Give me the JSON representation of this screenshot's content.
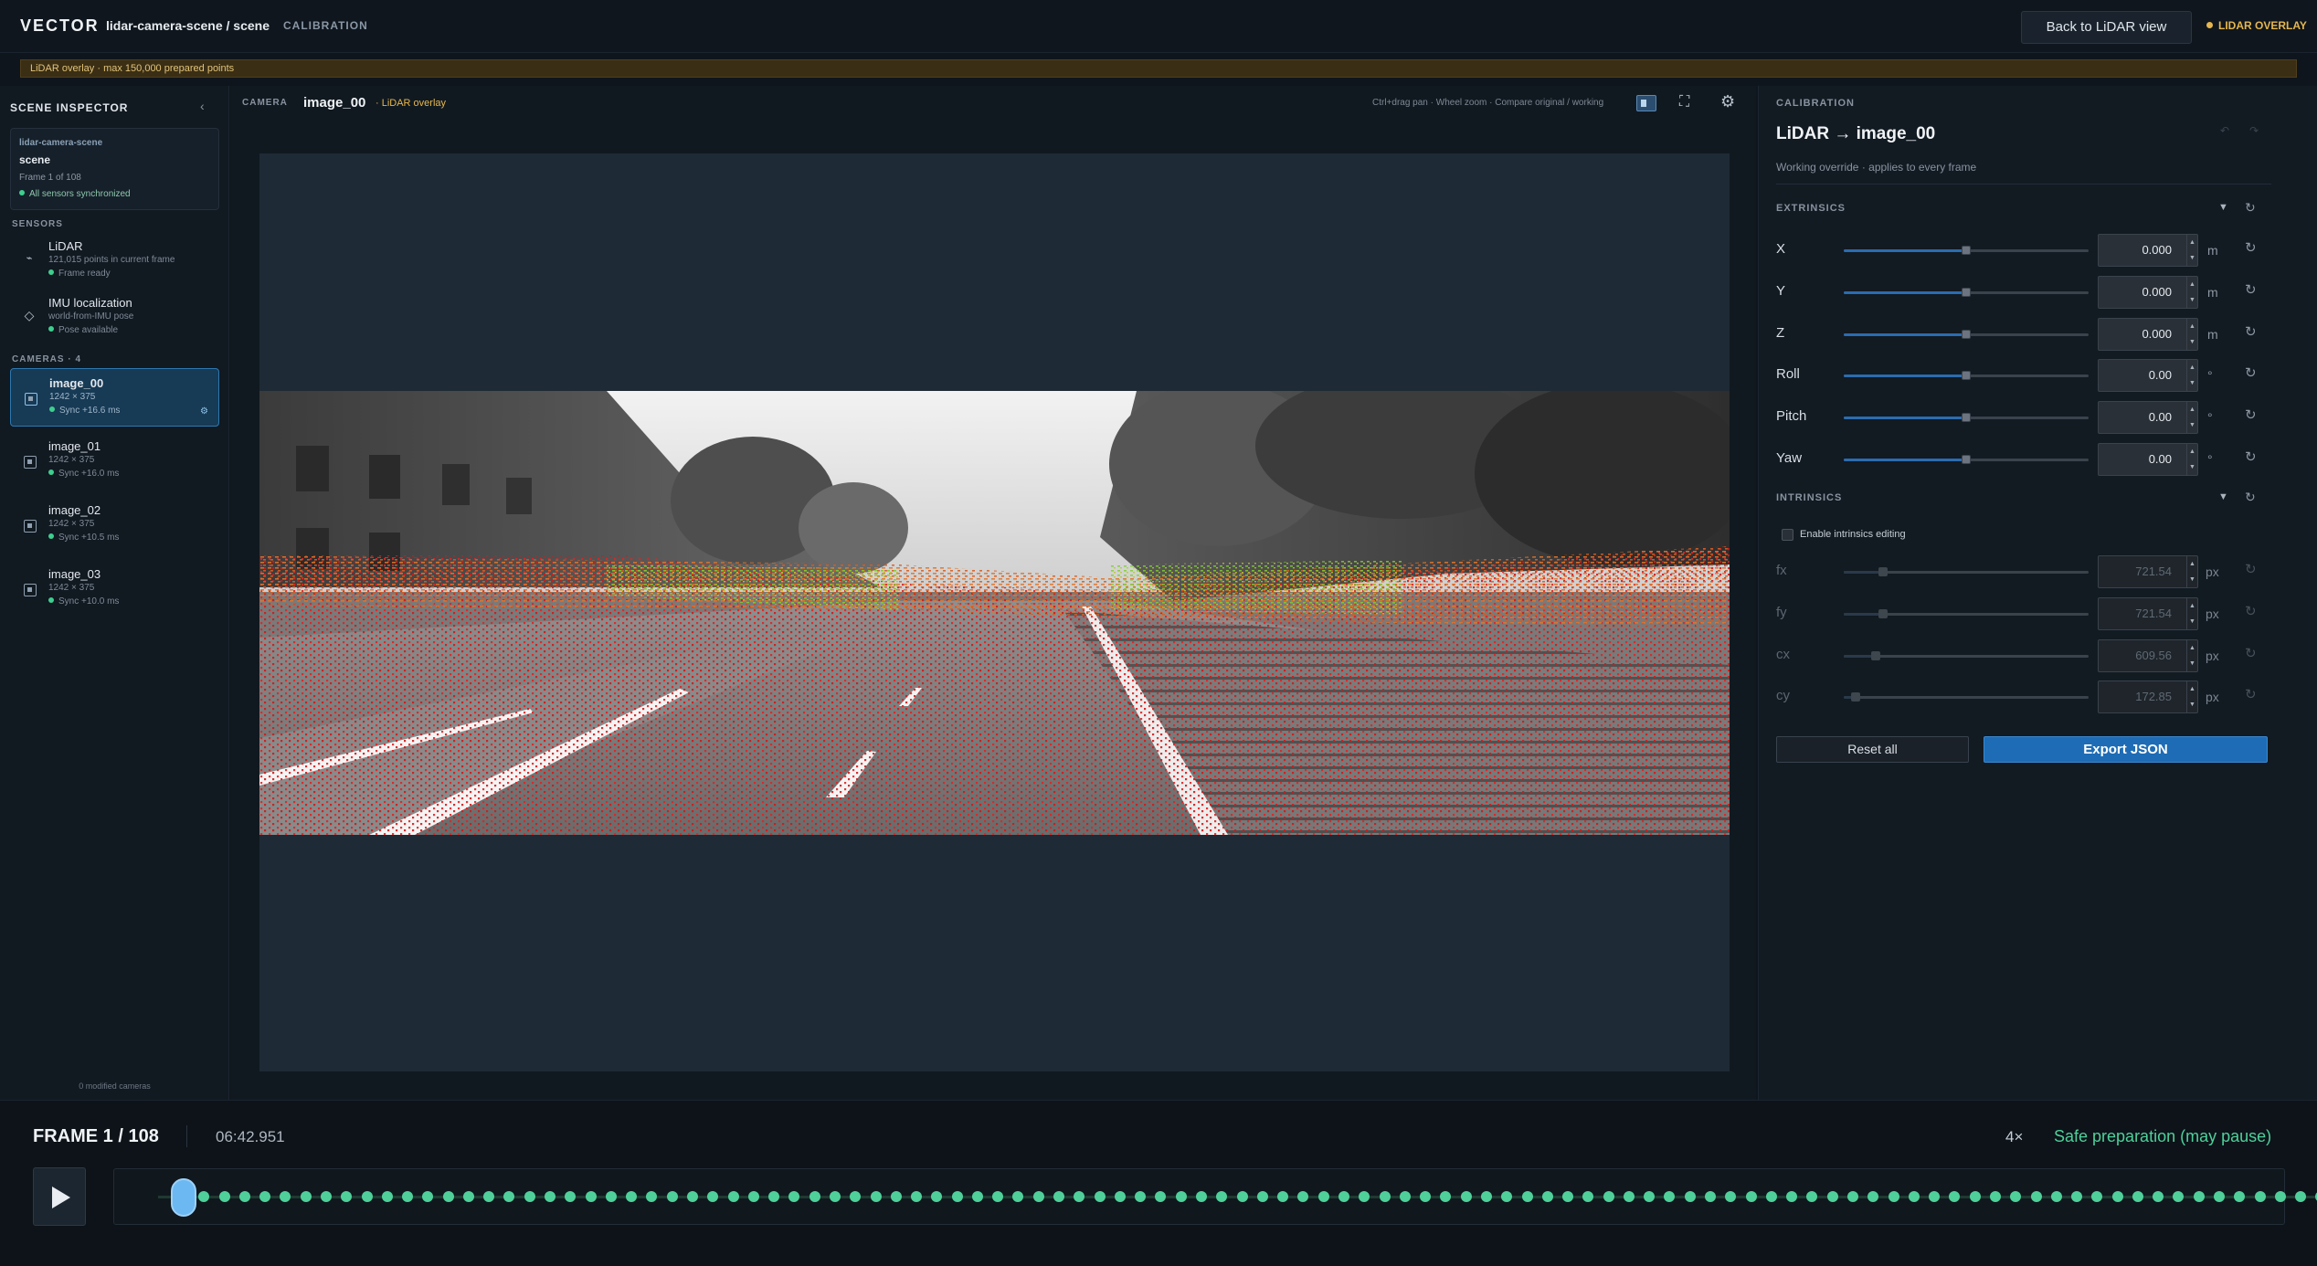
{
  "topbar": {
    "brand": "VECTOR",
    "breadcrumb": "lidar-camera-scene / scene",
    "mode": "CALIBRATION",
    "back_button": "Back to LiDAR view",
    "overlay_flag": "LIDAR OVERLAY"
  },
  "notice": "LiDAR overlay · max 150,000 prepared points",
  "sidebar": {
    "title": "SCENE INSPECTOR",
    "scene_card": {
      "dataset": "lidar-camera-scene",
      "scene": "scene",
      "frame": "Frame 1 of 108",
      "sync": "All sensors synchronized"
    },
    "sensors_title": "SENSORS",
    "sensors": [
      {
        "name": "LiDAR",
        "sub": "121,015 points in current frame",
        "status": "Frame ready",
        "icon": "lidar-icon"
      },
      {
        "name": "IMU localization",
        "sub": "world-from-IMU pose",
        "status": "Pose available",
        "icon": "diamond-icon"
      }
    ],
    "cameras_title": "CAMERAS · 4",
    "cameras": [
      {
        "name": "image_00",
        "res": "1242 × 375",
        "sync": "Sync +16.6 ms",
        "selected": true
      },
      {
        "name": "image_01",
        "res": "1242 × 375",
        "sync": "Sync +16.0 ms",
        "selected": false
      },
      {
        "name": "image_02",
        "res": "1242 × 375",
        "sync": "Sync +10.5 ms",
        "selected": false
      },
      {
        "name": "image_03",
        "res": "1242 × 375",
        "sync": "Sync +10.0 ms",
        "selected": false
      }
    ],
    "footer": "0 modified cameras"
  },
  "viewer": {
    "label": "CAMERA",
    "camera": "image_00",
    "overlay": "· LiDAR overlay",
    "hint": "Ctrl+drag pan · Wheel zoom · Compare original / working"
  },
  "calibration": {
    "section": "CALIBRATION",
    "title": "LiDAR → image_00",
    "subtitle": "Working override · applies to every frame",
    "extrinsics_title": "EXTRINSICS",
    "extrinsics": [
      {
        "label": "X",
        "value": "0.000",
        "unit": "m",
        "level": 0.5
      },
      {
        "label": "Y",
        "value": "0.000",
        "unit": "m",
        "level": 0.5
      },
      {
        "label": "Z",
        "value": "0.000",
        "unit": "m",
        "level": 0.5
      },
      {
        "label": "Roll",
        "value": "0.00",
        "unit": "°",
        "level": 0.5
      },
      {
        "label": "Pitch",
        "value": "0.00",
        "unit": "°",
        "level": 0.5
      },
      {
        "label": "Yaw",
        "value": "0.00",
        "unit": "°",
        "level": 0.5
      }
    ],
    "intrinsics_title": "INTRINSICS",
    "intrinsics_toggle": "Enable intrinsics editing",
    "intrinsics": [
      {
        "label": "fx",
        "value": "721.54",
        "unit": "px",
        "level": 0.16
      },
      {
        "label": "fy",
        "value": "721.54",
        "unit": "px",
        "level": 0.16
      },
      {
        "label": "cx",
        "value": "609.56",
        "unit": "px",
        "level": 0.13
      },
      {
        "label": "cy",
        "value": "172.85",
        "unit": "px",
        "level": 0.05
      }
    ],
    "reset_all": "Reset all",
    "export": "Export JSON"
  },
  "playback": {
    "frame": "FRAME 1 / 108",
    "time": "06:42.951",
    "speed": "4×",
    "status": "Safe preparation (may pause)",
    "current_frame": 1,
    "total_frames": 108
  },
  "colors": {
    "accent": "#2b6cb0",
    "export": "#1e6cb5",
    "ready": "#3ecf8e",
    "overlay": "#e5b64f",
    "timeline_dot": "#4fd09a"
  }
}
